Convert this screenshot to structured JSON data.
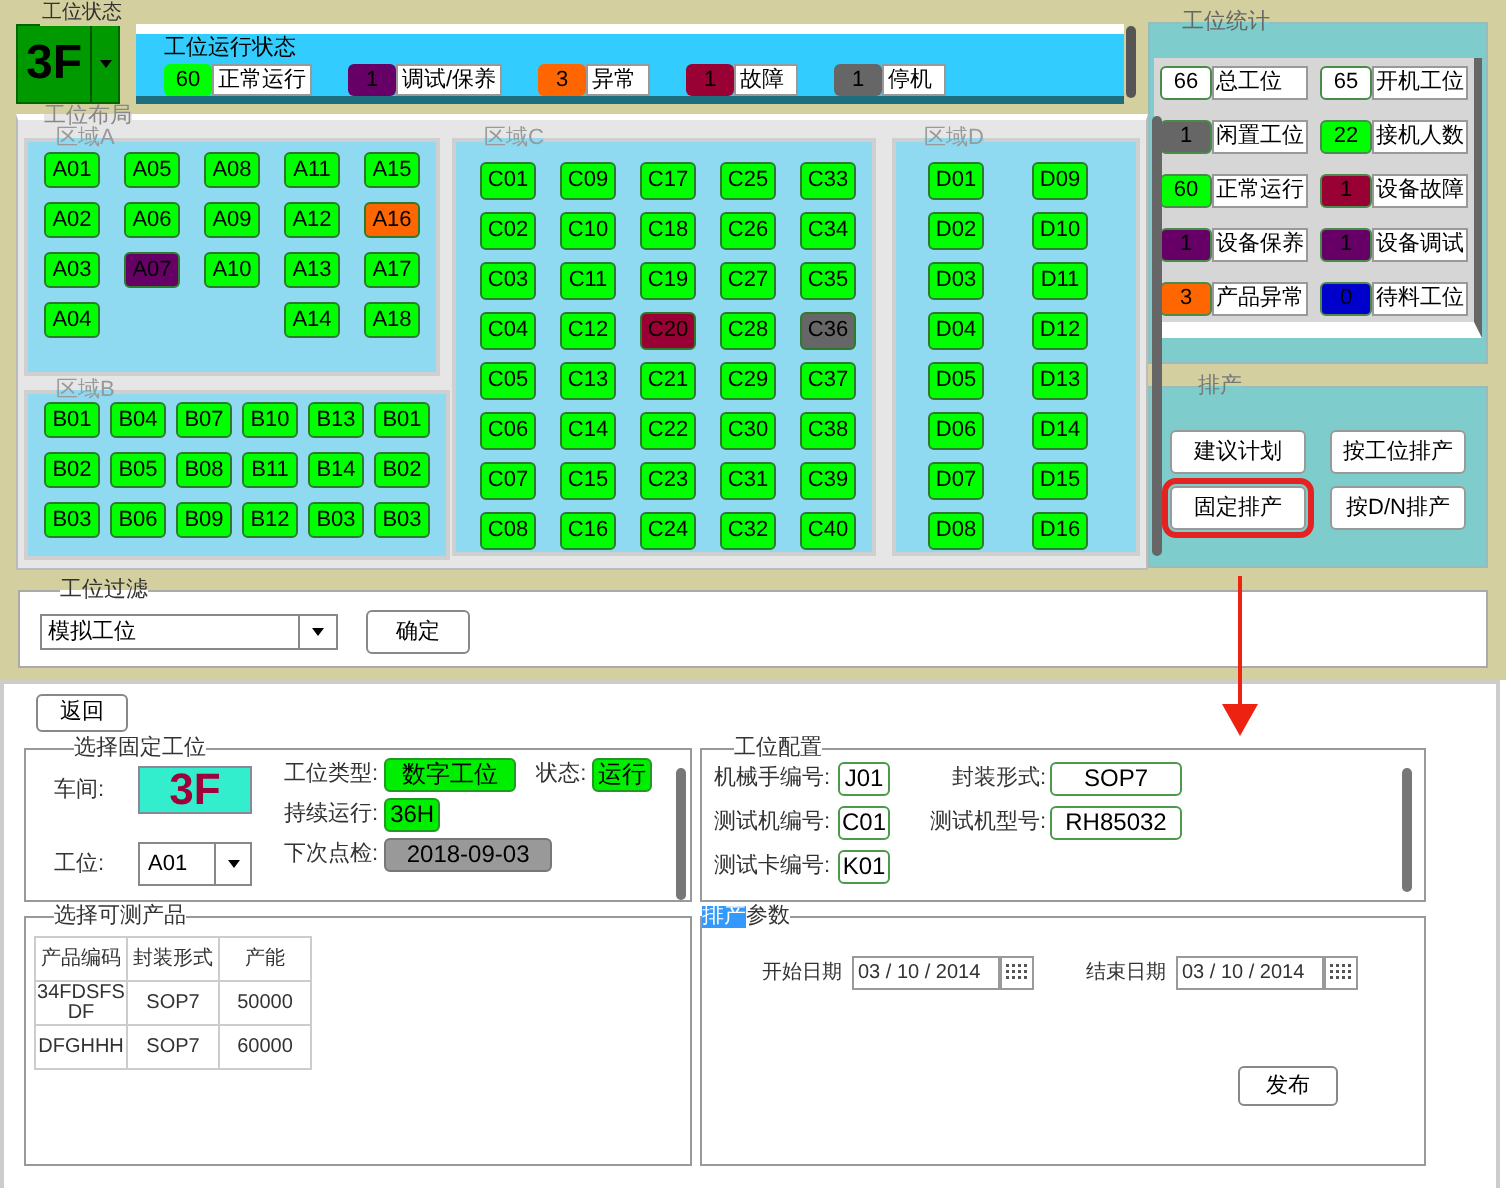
{
  "station_status": {
    "title": "工位状态",
    "floor": "3F"
  },
  "run_status": {
    "title": "工位运行状态",
    "items": [
      {
        "count": "60",
        "label": "正常运行",
        "color": "#00ff00"
      },
      {
        "count": "1",
        "label": "调试/保养",
        "color": "#660066"
      },
      {
        "count": "3",
        "label": "异常",
        "color": "#ff6600"
      },
      {
        "count": "1",
        "label": "故障",
        "color": "#990033"
      },
      {
        "count": "1",
        "label": "停机",
        "color": "#666666"
      }
    ]
  },
  "layout": {
    "title": "工位布局",
    "areas": [
      {
        "name": "区域A",
        "rows": [
          [
            {
              "id": "A01",
              "color": "#00ff00"
            },
            {
              "id": "A05",
              "color": "#00ff00"
            },
            {
              "id": "A08",
              "color": "#00ff00"
            },
            {
              "id": "A11",
              "color": "#00ff00"
            },
            {
              "id": "A15",
              "color": "#00ff00"
            }
          ],
          [
            {
              "id": "A02",
              "color": "#00ff00"
            },
            {
              "id": "A06",
              "color": "#00ff00"
            },
            {
              "id": "A09",
              "color": "#00ff00"
            },
            {
              "id": "A12",
              "color": "#00ff00"
            },
            {
              "id": "A16",
              "color": "#ff6600"
            }
          ],
          [
            {
              "id": "A03",
              "color": "#00ff00"
            },
            {
              "id": "A07",
              "color": "#660066"
            },
            {
              "id": "A10",
              "color": "#00ff00"
            },
            {
              "id": "A13",
              "color": "#00ff00"
            },
            {
              "id": "A17",
              "color": "#00ff00"
            }
          ],
          [
            {
              "id": "A04",
              "color": "#00ff00"
            },
            null,
            null,
            {
              "id": "A14",
              "color": "#00ff00"
            },
            {
              "id": "A18",
              "color": "#00ff00"
            }
          ]
        ]
      },
      {
        "name": "区域B",
        "rows": [
          [
            {
              "id": "B01",
              "color": "#00ff00"
            },
            {
              "id": "B04",
              "color": "#00ff00"
            },
            {
              "id": "B07",
              "color": "#00ff00"
            },
            {
              "id": "B10",
              "color": "#00ff00"
            },
            {
              "id": "B13",
              "color": "#00ff00"
            },
            {
              "id": "B01",
              "color": "#00ff00"
            }
          ],
          [
            {
              "id": "B02",
              "color": "#00ff00"
            },
            {
              "id": "B05",
              "color": "#00ff00"
            },
            {
              "id": "B08",
              "color": "#00ff00"
            },
            {
              "id": "B11",
              "color": "#00ff00"
            },
            {
              "id": "B14",
              "color": "#00ff00"
            },
            {
              "id": "B02",
              "color": "#00ff00"
            }
          ],
          [
            {
              "id": "B03",
              "color": "#00ff00"
            },
            {
              "id": "B06",
              "color": "#00ff00"
            },
            {
              "id": "B09",
              "color": "#00ff00"
            },
            {
              "id": "B12",
              "color": "#00ff00"
            },
            {
              "id": "B03",
              "color": "#00ff00"
            },
            {
              "id": "B03",
              "color": "#00ff00"
            }
          ]
        ]
      },
      {
        "name": "区域C",
        "rows": [
          [
            {
              "id": "C01",
              "color": "#00ff00"
            },
            {
              "id": "C09",
              "color": "#00ff00"
            },
            {
              "id": "C17",
              "color": "#00ff00"
            },
            {
              "id": "C25",
              "color": "#00ff00"
            },
            {
              "id": "C33",
              "color": "#00ff00"
            }
          ],
          [
            {
              "id": "C02",
              "color": "#00ff00"
            },
            {
              "id": "C10",
              "color": "#00ff00"
            },
            {
              "id": "C18",
              "color": "#00ff00"
            },
            {
              "id": "C26",
              "color": "#00ff00"
            },
            {
              "id": "C34",
              "color": "#00ff00"
            }
          ],
          [
            {
              "id": "C03",
              "color": "#00ff00"
            },
            {
              "id": "C11",
              "color": "#00ff00"
            },
            {
              "id": "C19",
              "color": "#00ff00"
            },
            {
              "id": "C27",
              "color": "#00ff00"
            },
            {
              "id": "C35",
              "color": "#00ff00"
            }
          ],
          [
            {
              "id": "C04",
              "color": "#00ff00"
            },
            {
              "id": "C12",
              "color": "#00ff00"
            },
            {
              "id": "C20",
              "color": "#990033"
            },
            {
              "id": "C28",
              "color": "#00ff00"
            },
            {
              "id": "C36",
              "color": "#666666"
            }
          ],
          [
            {
              "id": "C05",
              "color": "#00ff00"
            },
            {
              "id": "C13",
              "color": "#00ff00"
            },
            {
              "id": "C21",
              "color": "#00ff00"
            },
            {
              "id": "C29",
              "color": "#00ff00"
            },
            {
              "id": "C37",
              "color": "#00ff00"
            }
          ],
          [
            {
              "id": "C06",
              "color": "#00ff00"
            },
            {
              "id": "C14",
              "color": "#00ff00"
            },
            {
              "id": "C22",
              "color": "#00ff00"
            },
            {
              "id": "C30",
              "color": "#00ff00"
            },
            {
              "id": "C38",
              "color": "#00ff00"
            }
          ],
          [
            {
              "id": "C07",
              "color": "#00ff00"
            },
            {
              "id": "C15",
              "color": "#00ff00"
            },
            {
              "id": "C23",
              "color": "#00ff00"
            },
            {
              "id": "C31",
              "color": "#00ff00"
            },
            {
              "id": "C39",
              "color": "#00ff00"
            }
          ],
          [
            {
              "id": "C08",
              "color": "#00ff00"
            },
            {
              "id": "C16",
              "color": "#00ff00"
            },
            {
              "id": "C24",
              "color": "#00ff00"
            },
            {
              "id": "C32",
              "color": "#00ff00"
            },
            {
              "id": "C40",
              "color": "#00ff00"
            }
          ]
        ]
      },
      {
        "name": "区域D",
        "rows": [
          [
            {
              "id": "D01",
              "color": "#00ff00"
            },
            {
              "id": "D09",
              "color": "#00ff00"
            }
          ],
          [
            {
              "id": "D02",
              "color": "#00ff00"
            },
            {
              "id": "D10",
              "color": "#00ff00"
            }
          ],
          [
            {
              "id": "D03",
              "color": "#00ff00"
            },
            {
              "id": "D11",
              "color": "#00ff00"
            }
          ],
          [
            {
              "id": "D04",
              "color": "#00ff00"
            },
            {
              "id": "D12",
              "color": "#00ff00"
            }
          ],
          [
            {
              "id": "D05",
              "color": "#00ff00"
            },
            {
              "id": "D13",
              "color": "#00ff00"
            }
          ],
          [
            {
              "id": "D06",
              "color": "#00ff00"
            },
            {
              "id": "D14",
              "color": "#00ff00"
            }
          ],
          [
            {
              "id": "D07",
              "color": "#00ff00"
            },
            {
              "id": "D15",
              "color": "#00ff00"
            }
          ],
          [
            {
              "id": "D08",
              "color": "#00ff00"
            },
            {
              "id": "D16",
              "color": "#00ff00"
            }
          ]
        ]
      }
    ]
  },
  "statistics": {
    "title": "工位统计",
    "items": [
      {
        "count": "66",
        "label": "总工位",
        "color": "#ffffff"
      },
      {
        "count": "65",
        "label": "开机工位",
        "color": "#ffffff"
      },
      {
        "count": "1",
        "label": "闲置工位",
        "color": "#666666"
      },
      {
        "count": "22",
        "label": "接机人数",
        "color": "#00ff00"
      },
      {
        "count": "60",
        "label": "正常运行",
        "color": "#00ff00"
      },
      {
        "count": "1",
        "label": "设备故障",
        "color": "#990033"
      },
      {
        "count": "1",
        "label": "设备保养",
        "color": "#660066"
      },
      {
        "count": "1",
        "label": "设备调试",
        "color": "#660066"
      },
      {
        "count": "3",
        "label": "产品异常",
        "color": "#ff6600"
      },
      {
        "count": "0",
        "label": "待料工位",
        "color": "#0000cc"
      }
    ]
  },
  "scheduling": {
    "title": "排产",
    "buttons": [
      {
        "label": "建议计划",
        "highlighted": false
      },
      {
        "label": "按工位排产",
        "highlighted": false
      },
      {
        "label": "固定排产",
        "highlighted": true
      },
      {
        "label": "按D/N排产",
        "highlighted": false
      }
    ]
  },
  "filter": {
    "title": "工位过滤",
    "value": "模拟工位",
    "confirm": "确定"
  },
  "detail": {
    "back": "返回",
    "fixed_station": {
      "title": "选择固定工位",
      "workshop_label": "车间:",
      "workshop": "3F",
      "station_label": "工位:",
      "station": "A01",
      "fields": [
        {
          "label": "工位类型:",
          "value": "数字工位",
          "kind": "ok"
        },
        {
          "label": "状态:",
          "value": "运行",
          "kind": "ok"
        },
        {
          "label": "持续运行:",
          "value": "36H",
          "kind": "ok"
        },
        {
          "label": "下次点检:",
          "value": "2018-09-03",
          "kind": "neutral"
        }
      ]
    },
    "products": {
      "title": "选择可测产品",
      "columns": [
        "产品编码",
        "封装形式",
        "产能"
      ],
      "rows": [
        [
          "34FDSFSDF",
          "SOP7",
          "50000"
        ],
        [
          "DFGHHH",
          "SOP7",
          "60000"
        ]
      ]
    },
    "config": {
      "title": "工位配置",
      "fields": [
        {
          "label": "机械手编号:",
          "value": "J01"
        },
        {
          "label": "封装形式:",
          "value": "SOP7"
        },
        {
          "label": "测试机编号:",
          "value": "C01"
        },
        {
          "label": "测试机型号:",
          "value": "RH85032"
        },
        {
          "label": "测试卡编号:",
          "value": "K01"
        }
      ]
    },
    "params": {
      "title_parts": [
        {
          "text": "排产",
          "selected": true
        },
        {
          "text": "参数",
          "selected": false
        }
      ],
      "start_label": "开始日期",
      "start": "03 / 10 / 2014",
      "end_label": "结束日期",
      "end": "03 / 10 / 2014",
      "publish": "发布"
    }
  }
}
